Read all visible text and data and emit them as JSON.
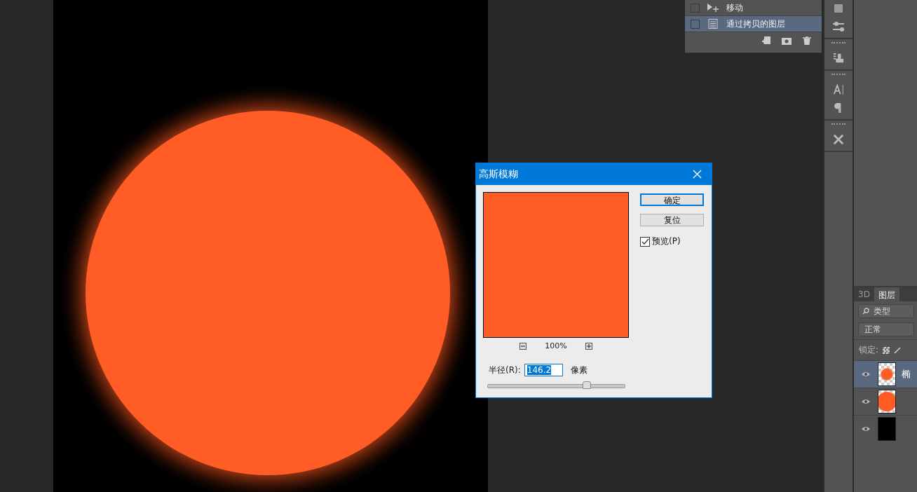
{
  "history": {
    "items": [
      {
        "label": "移动",
        "selected": false,
        "kind": "move"
      },
      {
        "label": "通过拷贝的图层",
        "selected": true,
        "kind": "layer"
      }
    ]
  },
  "dialog": {
    "title": "高斯模糊",
    "buttons": [
      {
        "label": "确定",
        "default": true
      },
      {
        "label": "复位",
        "default": false
      }
    ],
    "preview": {
      "label": "预览(P)",
      "checked": true
    },
    "zoom": "100%",
    "radius": {
      "label": "半径(R):",
      "value": "146.2",
      "unit": "像素",
      "level": 0.72
    }
  },
  "layers_panel": {
    "tabs": [
      {
        "label": "3D",
        "selected": false
      },
      {
        "label": "图层",
        "selected": true
      }
    ],
    "filter": "类型",
    "blend_mode": "正常",
    "lock_label": "锁定:",
    "layers": [
      {
        "name": "椭",
        "selected": true,
        "visible": true,
        "kind": "blur"
      },
      {
        "selected": false,
        "visible": true,
        "kind": "shape"
      },
      {
        "selected": false,
        "visible": true,
        "kind": "fill"
      }
    ]
  }
}
